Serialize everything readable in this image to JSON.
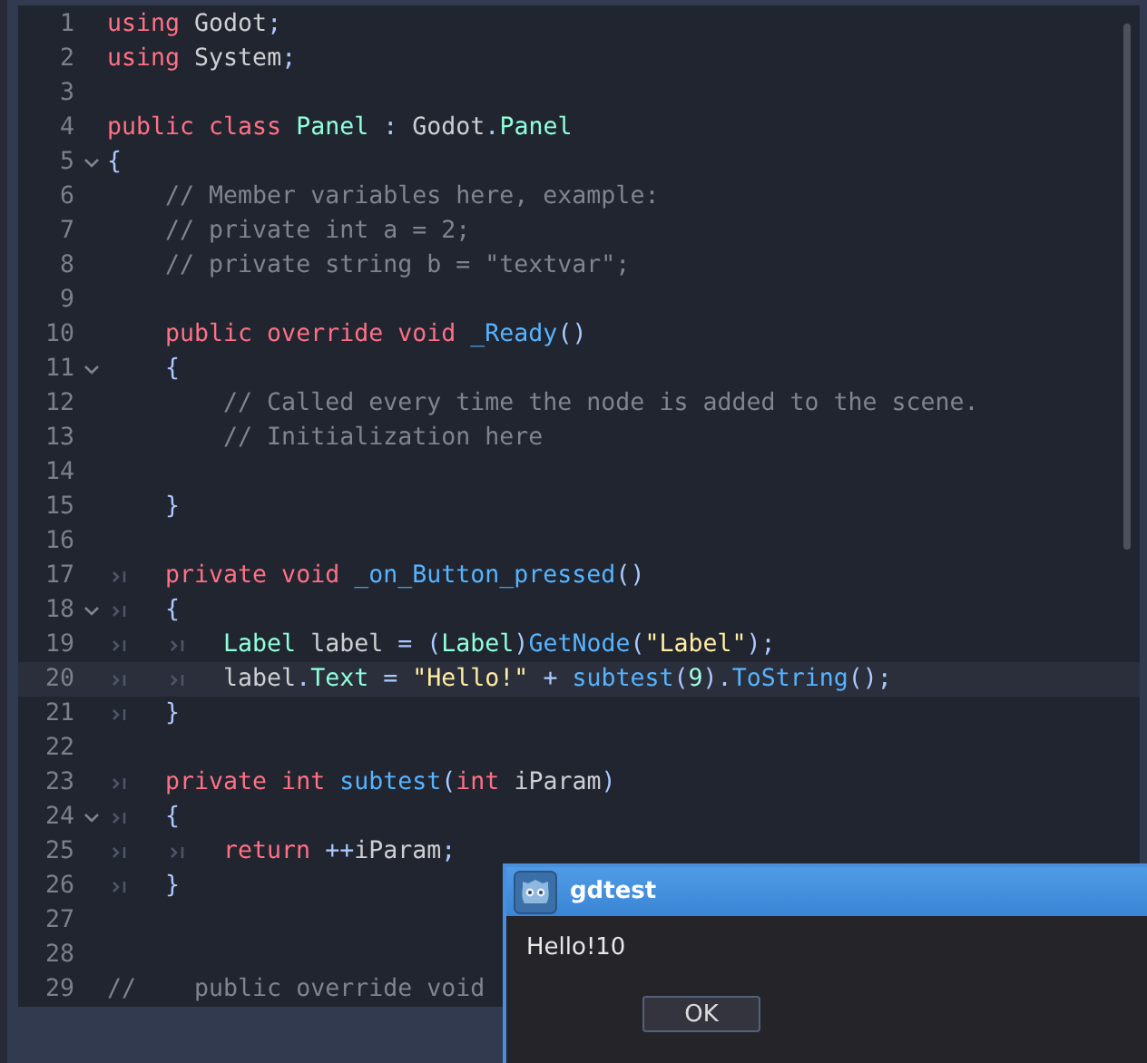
{
  "editor": {
    "lines": [
      {
        "number": "1",
        "fold": false,
        "current": false,
        "tokens": [
          {
            "kind": "keyword",
            "text": "using"
          },
          {
            "kind": "plain",
            "text": " Godot"
          },
          {
            "kind": "symbol",
            "text": ";"
          }
        ]
      },
      {
        "number": "2",
        "fold": false,
        "current": false,
        "tokens": [
          {
            "kind": "keyword",
            "text": "using"
          },
          {
            "kind": "plain",
            "text": " System"
          },
          {
            "kind": "symbol",
            "text": ";"
          }
        ]
      },
      {
        "number": "3",
        "fold": false,
        "current": false
      },
      {
        "number": "4",
        "fold": false,
        "current": false,
        "tokens": [
          {
            "kind": "keyword",
            "text": "public class "
          },
          {
            "kind": "type",
            "text": "Panel"
          },
          {
            "kind": "symbol",
            "text": " : "
          },
          {
            "kind": "plain",
            "text": "Godot"
          },
          {
            "kind": "symbol",
            "text": "."
          },
          {
            "kind": "type",
            "text": "Panel"
          }
        ]
      },
      {
        "number": "5",
        "fold": true,
        "current": false,
        "tokens": [
          {
            "kind": "symbol",
            "text": "{"
          }
        ]
      },
      {
        "number": "6",
        "fold": false,
        "current": false,
        "tokens": [
          {
            "kind": "indent"
          },
          {
            "kind": "comment",
            "text": "// Member variables here, example:"
          }
        ]
      },
      {
        "number": "7",
        "fold": false,
        "current": false,
        "tokens": [
          {
            "kind": "indent"
          },
          {
            "kind": "comment",
            "text": "// private int a = 2;"
          }
        ]
      },
      {
        "number": "8",
        "fold": false,
        "current": false,
        "tokens": [
          {
            "kind": "indent"
          },
          {
            "kind": "comment",
            "text": "// private string b = \"textvar\";"
          }
        ]
      },
      {
        "number": "9",
        "fold": false,
        "current": false
      },
      {
        "number": "10",
        "fold": false,
        "current": false,
        "tokens": [
          {
            "kind": "indent"
          },
          {
            "kind": "keyword",
            "text": "public override void "
          },
          {
            "kind": "function",
            "text": "_Ready"
          },
          {
            "kind": "symbol",
            "text": "()"
          }
        ]
      },
      {
        "number": "11",
        "fold": true,
        "current": false,
        "tokens": [
          {
            "kind": "indent"
          },
          {
            "kind": "symbol",
            "text": "{"
          }
        ]
      },
      {
        "number": "12",
        "fold": false,
        "current": false,
        "tokens": [
          {
            "kind": "indent"
          },
          {
            "kind": "indent"
          },
          {
            "kind": "comment",
            "text": "// Called every time the node is added to the scene."
          }
        ]
      },
      {
        "number": "13",
        "fold": false,
        "current": false,
        "tokens": [
          {
            "kind": "indent"
          },
          {
            "kind": "indent"
          },
          {
            "kind": "comment",
            "text": "// Initialization here"
          }
        ]
      },
      {
        "number": "14",
        "fold": false,
        "current": false
      },
      {
        "number": "15",
        "fold": false,
        "current": false,
        "tokens": [
          {
            "kind": "indent"
          },
          {
            "kind": "symbol",
            "text": "}"
          }
        ]
      },
      {
        "number": "16",
        "fold": false,
        "current": false
      },
      {
        "number": "17",
        "fold": false,
        "current": false,
        "tokens": [
          {
            "kind": "tab"
          },
          {
            "kind": "keyword",
            "text": "private void "
          },
          {
            "kind": "function",
            "text": "_on_Button_pressed"
          },
          {
            "kind": "symbol",
            "text": "()"
          }
        ]
      },
      {
        "number": "18",
        "fold": true,
        "current": false,
        "tokens": [
          {
            "kind": "tab"
          },
          {
            "kind": "symbol",
            "text": "{"
          }
        ]
      },
      {
        "number": "19",
        "fold": false,
        "current": false,
        "tokens": [
          {
            "kind": "tab"
          },
          {
            "kind": "tab"
          },
          {
            "kind": "type",
            "text": "Label"
          },
          {
            "kind": "plain",
            "text": " label "
          },
          {
            "kind": "symbol",
            "text": "= ("
          },
          {
            "kind": "type",
            "text": "Label"
          },
          {
            "kind": "symbol",
            "text": ")"
          },
          {
            "kind": "function",
            "text": "GetNode"
          },
          {
            "kind": "symbol",
            "text": "("
          },
          {
            "kind": "string",
            "text": "\"Label\""
          },
          {
            "kind": "symbol",
            "text": ");"
          }
        ]
      },
      {
        "number": "20",
        "fold": false,
        "current": true,
        "tokens": [
          {
            "kind": "tab"
          },
          {
            "kind": "tab"
          },
          {
            "kind": "plain",
            "text": "label"
          },
          {
            "kind": "symbol",
            "text": "."
          },
          {
            "kind": "type",
            "text": "Text"
          },
          {
            "kind": "symbol",
            "text": " = "
          },
          {
            "kind": "string",
            "text": "\"Hello!\""
          },
          {
            "kind": "symbol",
            "text": " + "
          },
          {
            "kind": "function",
            "text": "subtest"
          },
          {
            "kind": "symbol",
            "text": "("
          },
          {
            "kind": "number",
            "text": "9"
          },
          {
            "kind": "symbol",
            "text": ")."
          },
          {
            "kind": "function",
            "text": "ToString"
          },
          {
            "kind": "symbol",
            "text": "();"
          }
        ]
      },
      {
        "number": "21",
        "fold": false,
        "current": false,
        "tokens": [
          {
            "kind": "tab"
          },
          {
            "kind": "symbol",
            "text": "}"
          }
        ]
      },
      {
        "number": "22",
        "fold": false,
        "current": false
      },
      {
        "number": "23",
        "fold": false,
        "current": false,
        "tokens": [
          {
            "kind": "tab"
          },
          {
            "kind": "keyword",
            "text": "private int "
          },
          {
            "kind": "function",
            "text": "subtest"
          },
          {
            "kind": "symbol",
            "text": "("
          },
          {
            "kind": "keyword",
            "text": "int"
          },
          {
            "kind": "plain",
            "text": " iParam"
          },
          {
            "kind": "symbol",
            "text": ")"
          }
        ]
      },
      {
        "number": "24",
        "fold": true,
        "current": false,
        "tokens": [
          {
            "kind": "tab"
          },
          {
            "kind": "symbol",
            "text": "{"
          }
        ]
      },
      {
        "number": "25",
        "fold": false,
        "current": false,
        "tokens": [
          {
            "kind": "tab"
          },
          {
            "kind": "tab"
          },
          {
            "kind": "keyword",
            "text": "return "
          },
          {
            "kind": "symbol",
            "text": "++"
          },
          {
            "kind": "plain",
            "text": "iParam"
          },
          {
            "kind": "symbol",
            "text": ";"
          }
        ]
      },
      {
        "number": "26",
        "fold": false,
        "current": false,
        "tokens": [
          {
            "kind": "tab"
          },
          {
            "kind": "symbol",
            "text": "}"
          }
        ]
      },
      {
        "number": "27",
        "fold": false,
        "current": false
      },
      {
        "number": "28",
        "fold": false,
        "current": false
      },
      {
        "number": "29",
        "fold": false,
        "current": false,
        "tokens": [
          {
            "kind": "comment",
            "text": "//    public override void"
          }
        ]
      }
    ]
  },
  "dialog": {
    "title": "gdtest",
    "message": "Hello!10",
    "button": "OK"
  }
}
